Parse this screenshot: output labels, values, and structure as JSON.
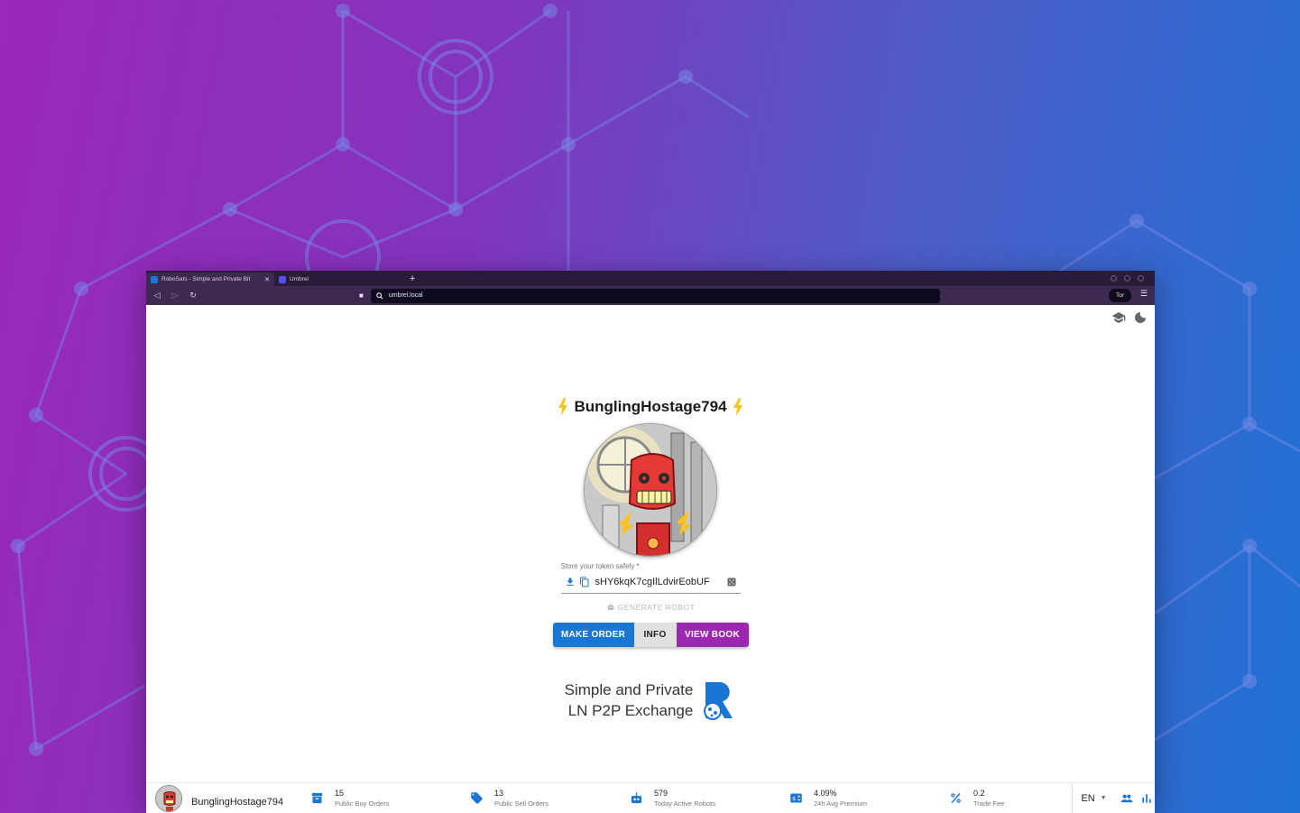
{
  "browser": {
    "tabs": [
      {
        "title": "RoboSats - Simple and Private Bit",
        "active": true
      },
      {
        "title": "Umbrel",
        "active": false
      }
    ],
    "new_tab_icon": "plus-icon",
    "address": "umbrel.local",
    "tor_label": "Tor"
  },
  "page": {
    "robot_name": "BunglingHostage794",
    "token_label": "Store your token safely *",
    "token_value": "sHY6kqK7cgIlLdvirEobUF",
    "generate_robot_label": "GENERATE ROBOT",
    "buttons": {
      "make_order": "MAKE ORDER",
      "info": "INFO",
      "view_book": "VIEW BOOK"
    },
    "tagline_line1": "Simple and Private",
    "tagline_line2": "LN P2P Exchange"
  },
  "bottom_bar": {
    "robot_name": "BunglingHostage794",
    "stats": [
      {
        "value": "15",
        "label": "Public Buy Orders",
        "icon": "inventory-icon"
      },
      {
        "value": "13",
        "label": "Public Sell Orders",
        "icon": "tag-icon"
      },
      {
        "value": "579",
        "label": "Today Active Robots",
        "icon": "robot-icon"
      },
      {
        "value": "4.09%",
        "label": "24h Avg Premium",
        "icon": "price-change-icon"
      },
      {
        "value": "0.2",
        "label": "Trade Fee",
        "icon": "percent-icon"
      }
    ],
    "language": "EN"
  },
  "colors": {
    "primary": "#1976d2",
    "secondary": "#9c27b0",
    "bolt": "#fcc419"
  }
}
